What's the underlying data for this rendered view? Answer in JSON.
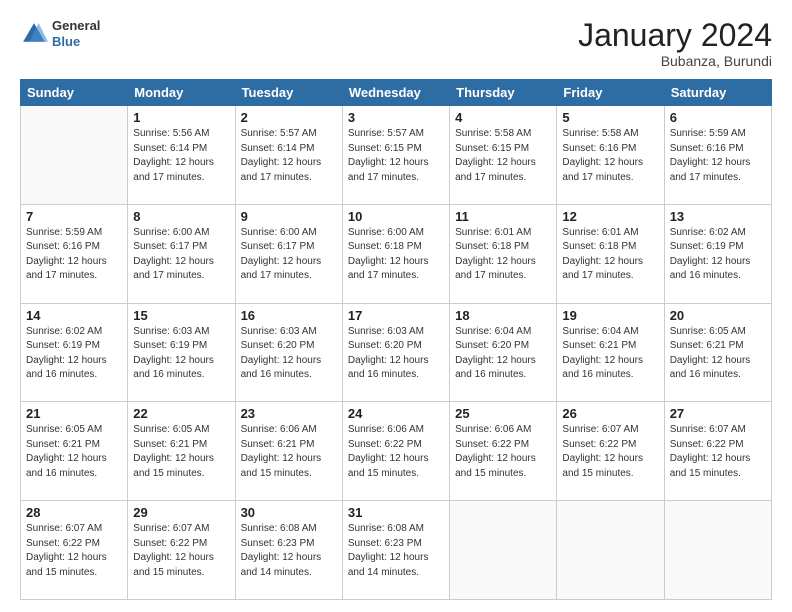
{
  "header": {
    "logo": {
      "general": "General",
      "blue": "Blue"
    },
    "title": "January 2024",
    "location": "Bubanza, Burundi"
  },
  "weekdays": [
    "Sunday",
    "Monday",
    "Tuesday",
    "Wednesday",
    "Thursday",
    "Friday",
    "Saturday"
  ],
  "weeks": [
    [
      {
        "day": "",
        "sunrise": "",
        "sunset": "",
        "daylight": ""
      },
      {
        "day": "1",
        "sunrise": "Sunrise: 5:56 AM",
        "sunset": "Sunset: 6:14 PM",
        "daylight": "Daylight: 12 hours and 17 minutes."
      },
      {
        "day": "2",
        "sunrise": "Sunrise: 5:57 AM",
        "sunset": "Sunset: 6:14 PM",
        "daylight": "Daylight: 12 hours and 17 minutes."
      },
      {
        "day": "3",
        "sunrise": "Sunrise: 5:57 AM",
        "sunset": "Sunset: 6:15 PM",
        "daylight": "Daylight: 12 hours and 17 minutes."
      },
      {
        "day": "4",
        "sunrise": "Sunrise: 5:58 AM",
        "sunset": "Sunset: 6:15 PM",
        "daylight": "Daylight: 12 hours and 17 minutes."
      },
      {
        "day": "5",
        "sunrise": "Sunrise: 5:58 AM",
        "sunset": "Sunset: 6:16 PM",
        "daylight": "Daylight: 12 hours and 17 minutes."
      },
      {
        "day": "6",
        "sunrise": "Sunrise: 5:59 AM",
        "sunset": "Sunset: 6:16 PM",
        "daylight": "Daylight: 12 hours and 17 minutes."
      }
    ],
    [
      {
        "day": "7",
        "sunrise": "Sunrise: 5:59 AM",
        "sunset": "Sunset: 6:16 PM",
        "daylight": "Daylight: 12 hours and 17 minutes."
      },
      {
        "day": "8",
        "sunrise": "Sunrise: 6:00 AM",
        "sunset": "Sunset: 6:17 PM",
        "daylight": "Daylight: 12 hours and 17 minutes."
      },
      {
        "day": "9",
        "sunrise": "Sunrise: 6:00 AM",
        "sunset": "Sunset: 6:17 PM",
        "daylight": "Daylight: 12 hours and 17 minutes."
      },
      {
        "day": "10",
        "sunrise": "Sunrise: 6:00 AM",
        "sunset": "Sunset: 6:18 PM",
        "daylight": "Daylight: 12 hours and 17 minutes."
      },
      {
        "day": "11",
        "sunrise": "Sunrise: 6:01 AM",
        "sunset": "Sunset: 6:18 PM",
        "daylight": "Daylight: 12 hours and 17 minutes."
      },
      {
        "day": "12",
        "sunrise": "Sunrise: 6:01 AM",
        "sunset": "Sunset: 6:18 PM",
        "daylight": "Daylight: 12 hours and 17 minutes."
      },
      {
        "day": "13",
        "sunrise": "Sunrise: 6:02 AM",
        "sunset": "Sunset: 6:19 PM",
        "daylight": "Daylight: 12 hours and 16 minutes."
      }
    ],
    [
      {
        "day": "14",
        "sunrise": "Sunrise: 6:02 AM",
        "sunset": "Sunset: 6:19 PM",
        "daylight": "Daylight: 12 hours and 16 minutes."
      },
      {
        "day": "15",
        "sunrise": "Sunrise: 6:03 AM",
        "sunset": "Sunset: 6:19 PM",
        "daylight": "Daylight: 12 hours and 16 minutes."
      },
      {
        "day": "16",
        "sunrise": "Sunrise: 6:03 AM",
        "sunset": "Sunset: 6:20 PM",
        "daylight": "Daylight: 12 hours and 16 minutes."
      },
      {
        "day": "17",
        "sunrise": "Sunrise: 6:03 AM",
        "sunset": "Sunset: 6:20 PM",
        "daylight": "Daylight: 12 hours and 16 minutes."
      },
      {
        "day": "18",
        "sunrise": "Sunrise: 6:04 AM",
        "sunset": "Sunset: 6:20 PM",
        "daylight": "Daylight: 12 hours and 16 minutes."
      },
      {
        "day": "19",
        "sunrise": "Sunrise: 6:04 AM",
        "sunset": "Sunset: 6:21 PM",
        "daylight": "Daylight: 12 hours and 16 minutes."
      },
      {
        "day": "20",
        "sunrise": "Sunrise: 6:05 AM",
        "sunset": "Sunset: 6:21 PM",
        "daylight": "Daylight: 12 hours and 16 minutes."
      }
    ],
    [
      {
        "day": "21",
        "sunrise": "Sunrise: 6:05 AM",
        "sunset": "Sunset: 6:21 PM",
        "daylight": "Daylight: 12 hours and 16 minutes."
      },
      {
        "day": "22",
        "sunrise": "Sunrise: 6:05 AM",
        "sunset": "Sunset: 6:21 PM",
        "daylight": "Daylight: 12 hours and 15 minutes."
      },
      {
        "day": "23",
        "sunrise": "Sunrise: 6:06 AM",
        "sunset": "Sunset: 6:21 PM",
        "daylight": "Daylight: 12 hours and 15 minutes."
      },
      {
        "day": "24",
        "sunrise": "Sunrise: 6:06 AM",
        "sunset": "Sunset: 6:22 PM",
        "daylight": "Daylight: 12 hours and 15 minutes."
      },
      {
        "day": "25",
        "sunrise": "Sunrise: 6:06 AM",
        "sunset": "Sunset: 6:22 PM",
        "daylight": "Daylight: 12 hours and 15 minutes."
      },
      {
        "day": "26",
        "sunrise": "Sunrise: 6:07 AM",
        "sunset": "Sunset: 6:22 PM",
        "daylight": "Daylight: 12 hours and 15 minutes."
      },
      {
        "day": "27",
        "sunrise": "Sunrise: 6:07 AM",
        "sunset": "Sunset: 6:22 PM",
        "daylight": "Daylight: 12 hours and 15 minutes."
      }
    ],
    [
      {
        "day": "28",
        "sunrise": "Sunrise: 6:07 AM",
        "sunset": "Sunset: 6:22 PM",
        "daylight": "Daylight: 12 hours and 15 minutes."
      },
      {
        "day": "29",
        "sunrise": "Sunrise: 6:07 AM",
        "sunset": "Sunset: 6:22 PM",
        "daylight": "Daylight: 12 hours and 15 minutes."
      },
      {
        "day": "30",
        "sunrise": "Sunrise: 6:08 AM",
        "sunset": "Sunset: 6:23 PM",
        "daylight": "Daylight: 12 hours and 14 minutes."
      },
      {
        "day": "31",
        "sunrise": "Sunrise: 6:08 AM",
        "sunset": "Sunset: 6:23 PM",
        "daylight": "Daylight: 12 hours and 14 minutes."
      },
      {
        "day": "",
        "sunrise": "",
        "sunset": "",
        "daylight": ""
      },
      {
        "day": "",
        "sunrise": "",
        "sunset": "",
        "daylight": ""
      },
      {
        "day": "",
        "sunrise": "",
        "sunset": "",
        "daylight": ""
      }
    ]
  ]
}
